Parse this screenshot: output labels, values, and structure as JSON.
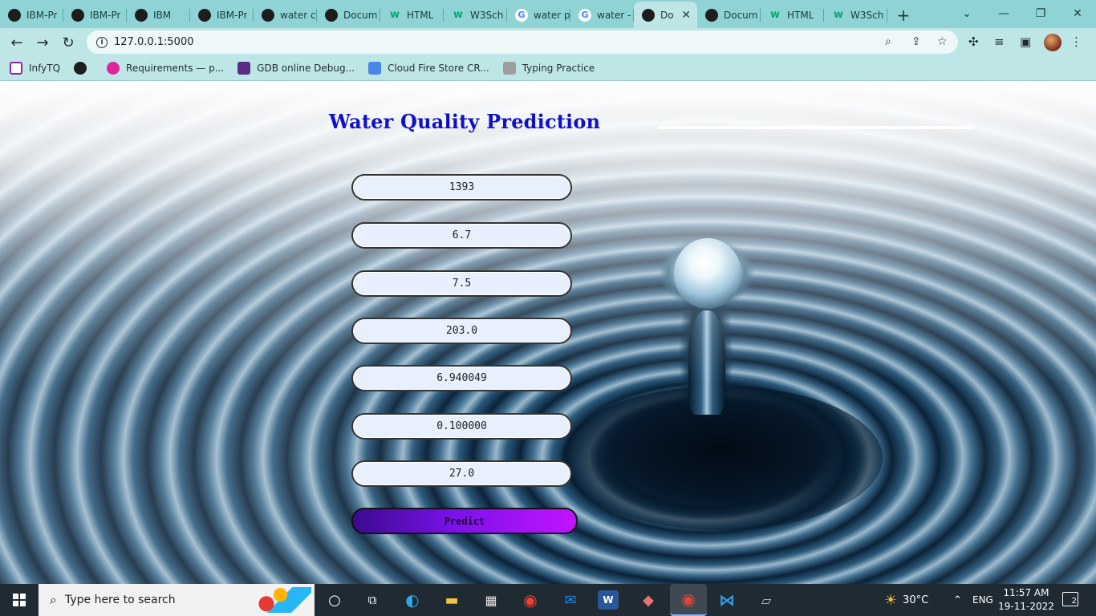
{
  "browser": {
    "tabs": [
      {
        "label": "IBM-Pr",
        "icon": "github-icon"
      },
      {
        "label": "IBM-Pr",
        "icon": "github-icon"
      },
      {
        "label": "IBM",
        "icon": "globe-icon"
      },
      {
        "label": "IBM-Pr",
        "icon": "github-icon"
      },
      {
        "label": "water c",
        "icon": "globe-icon"
      },
      {
        "label": "Docum",
        "icon": "globe-icon"
      },
      {
        "label": "HTML",
        "icon": "w3schools-icon"
      },
      {
        "label": "W3Sch",
        "icon": "w3schools-icon"
      },
      {
        "label": "water p",
        "icon": "google-icon"
      },
      {
        "label": "water -",
        "icon": "google-icon"
      },
      {
        "label": "Do",
        "icon": "globe-icon",
        "active": true
      },
      {
        "label": "Docum",
        "icon": "globe-icon"
      },
      {
        "label": "HTML",
        "icon": "w3schools-icon"
      },
      {
        "label": "W3Sch",
        "icon": "w3schools-icon"
      }
    ],
    "new_tab": "+",
    "url": "127.0.0.1:5000",
    "bookmarks": [
      {
        "label": "InfyTQ"
      },
      {
        "label": ""
      },
      {
        "label": "Requirements — p..."
      },
      {
        "label": "GDB online Debug..."
      },
      {
        "label": "Cloud Fire Store CR..."
      },
      {
        "label": "Typing Practice"
      }
    ]
  },
  "page": {
    "title": "Water Quality Prediction",
    "fields": [
      {
        "value": "1393"
      },
      {
        "value": "6.7"
      },
      {
        "value": "7.5"
      },
      {
        "value": "203.0"
      },
      {
        "value": "6.940049"
      },
      {
        "value": "0.100000"
      },
      {
        "value": "27.0"
      }
    ],
    "predict_label": "Predict",
    "title_color": "#1010cc",
    "button_gradient": [
      "#3b0a8e",
      "#c313ff"
    ]
  },
  "taskbar": {
    "search_placeholder": "Type here to search",
    "weather": "30°C",
    "language": "ENG",
    "time": "11:57 AM",
    "date": "19-11-2022",
    "notifications": "2"
  }
}
